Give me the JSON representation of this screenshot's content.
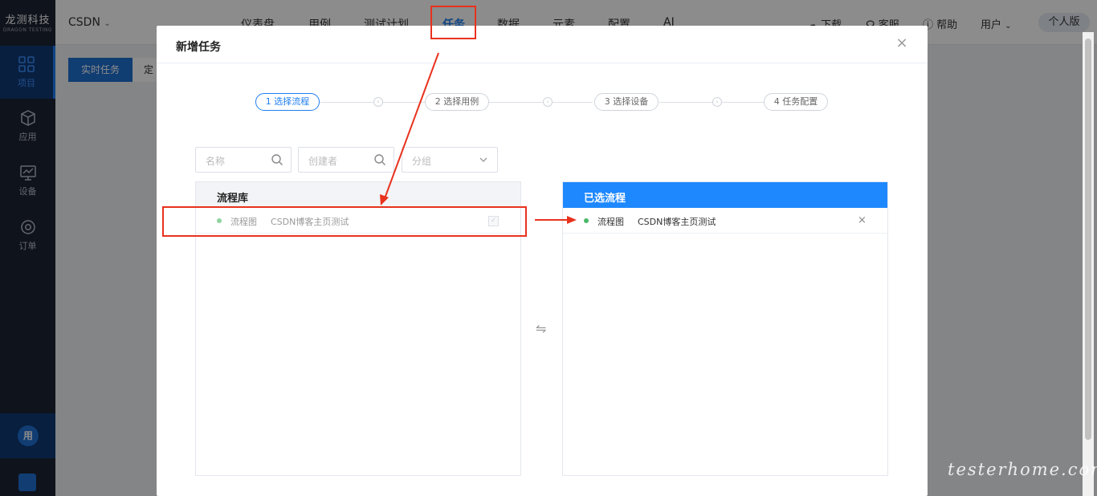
{
  "app": {
    "logo_cn": "龙测科技",
    "logo_en": "DRAGON TESTING",
    "project": "CSDN"
  },
  "sidebar": {
    "items": [
      {
        "label": "项目",
        "icon": "grid-icon"
      },
      {
        "label": "应用",
        "icon": "cube-icon"
      },
      {
        "label": "设备",
        "icon": "monitor-icon"
      },
      {
        "label": "订单",
        "icon": "gear-icon"
      }
    ],
    "user_badge": "用"
  },
  "nav": {
    "items": [
      "仪表盘",
      "用例",
      "测试计划",
      "任务",
      "数据",
      "元素",
      "配置",
      "AI"
    ],
    "active": "任务"
  },
  "header_right": {
    "download": "下载",
    "support": "客服",
    "help": "帮助",
    "user": "用户",
    "edition": "个人版"
  },
  "toolbar": {
    "realtime_tab": "实时任务",
    "scheduled_tab": "定"
  },
  "modal": {
    "title": "新增任务",
    "close": "×",
    "steps": [
      "1 选择流程",
      "2 选择用例",
      "3 选择设备",
      "4 任务配置"
    ],
    "active_step": 1,
    "filters": {
      "name_placeholder": "名称",
      "creator_placeholder": "创建者",
      "group_placeholder": "分组"
    },
    "library": {
      "title": "流程库",
      "rows": [
        {
          "type": "流程图",
          "name": "CSDN博客主页测试",
          "checked": true
        }
      ]
    },
    "selected": {
      "title": "已选流程",
      "rows": [
        {
          "type": "流程图",
          "name": "CSDN博客主页测试"
        }
      ]
    },
    "swap_symbol": "⇋"
  },
  "watermark": "testerhome.com",
  "colors": {
    "sidebar_bg": "#1d2433",
    "primary": "#1e7ef0",
    "selected_header": "#1e88ff",
    "annotation_red": "#e8321e"
  }
}
